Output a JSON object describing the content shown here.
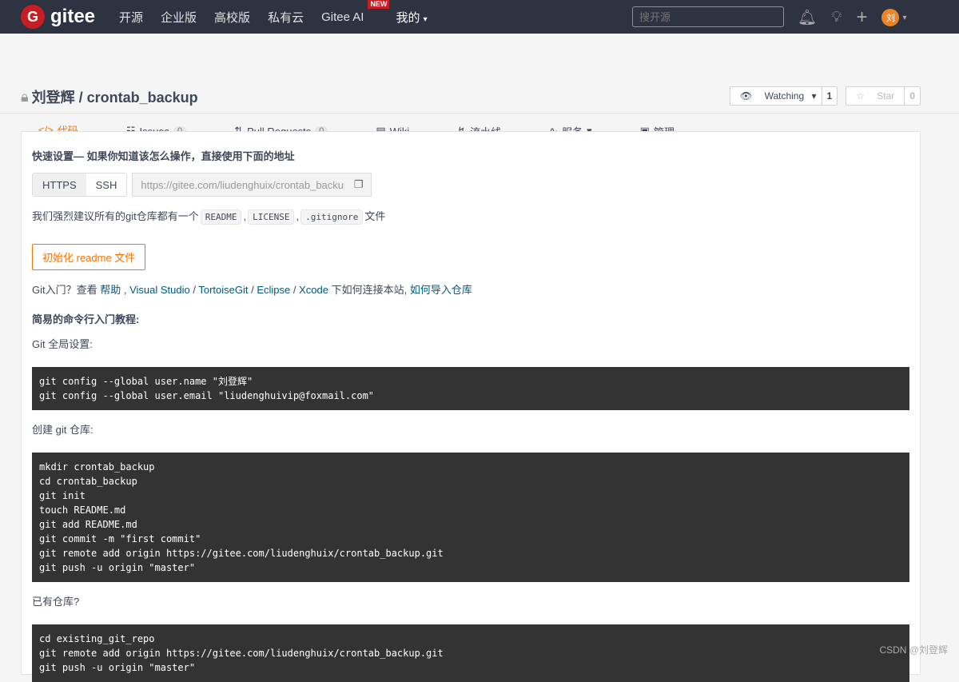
{
  "nav": {
    "logo": "gitee",
    "items": [
      "开源",
      "企业版",
      "高校版",
      "私有云",
      "Gitee AI"
    ],
    "new_badge": "NEW",
    "me": "我的",
    "search_placeholder": "搜开源",
    "avatar": "刘"
  },
  "repo": {
    "title": "刘登辉 / crontab_backup",
    "watch_label": "Watching",
    "watch_count": "1",
    "star_label": "Star",
    "star_count": "0"
  },
  "tabs": [
    {
      "label": "代码"
    },
    {
      "label": "Issues",
      "count": "0"
    },
    {
      "label": "Pull Requests",
      "count": "0"
    },
    {
      "label": "Wiki"
    },
    {
      "label": "流水线"
    },
    {
      "label": "服务"
    },
    {
      "label": "管理"
    }
  ],
  "setup": {
    "heading": "快速设置— 如果你知道该怎么操作，直接使用下面的地址",
    "https": "HTTPS",
    "ssh": "SSH",
    "url": "https://gitee.com/liudenghuix/crontab_backup.git",
    "recommend_prefix": "我们强烈建议所有的git仓库都有一个",
    "files": [
      "README",
      "LICENSE",
      ".gitignore"
    ],
    "recommend_suffix": "文件",
    "init_button": "初始化 readme 文件",
    "help_prefix": "Git入门？查看 ",
    "help_link": "帮助",
    "links": [
      "Visual Studio",
      "TortoiseGit",
      "Eclipse",
      "Xcode"
    ],
    "help_mid": " 下如何连接本站, ",
    "import_link": "如何导入仓库"
  },
  "tutorial": {
    "heading": "简易的命令行入门教程:",
    "global_label": "Git 全局设置:",
    "global_code": "git config --global user.name \"刘登辉\"\ngit config --global user.email \"liudenghuivip@foxmail.com\"",
    "create_label": "创建 git 仓库:",
    "create_code": "mkdir crontab_backup\ncd crontab_backup\ngit init\ntouch README.md\ngit add README.md\ngit commit -m \"first commit\"\ngit remote add origin https://gitee.com/liudenghuix/crontab_backup.git\ngit push -u origin \"master\"",
    "existing_label": "已有仓库?",
    "existing_code": "cd existing_git_repo\ngit remote add origin https://gitee.com/liudenghuix/crontab_backup.git\ngit push -u origin \"master\""
  },
  "watermark": "CSDN @刘登辉"
}
